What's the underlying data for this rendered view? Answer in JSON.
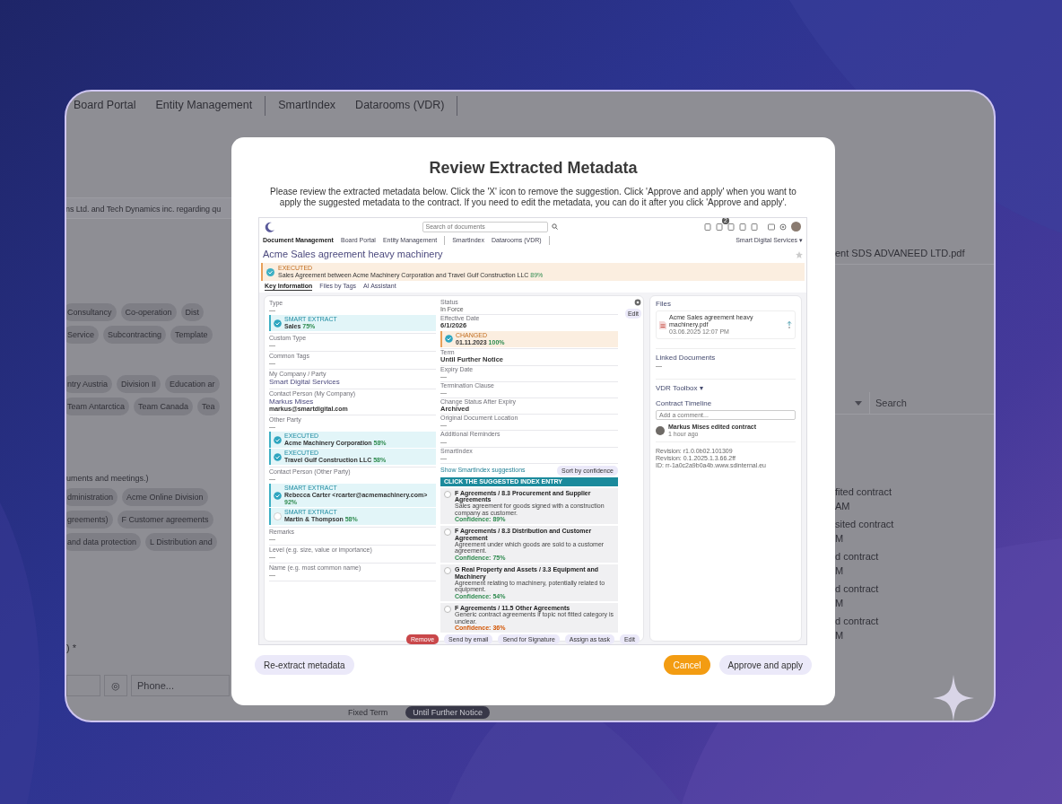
{
  "background": {
    "nav": [
      "Board Portal",
      "Entity Management",
      "SmartIndex",
      "Datarooms (VDR)"
    ],
    "left": [
      {
        "kind": "field",
        "text": "ns Ltd. and Tech Dynamics inc. regarding qu"
      },
      {
        "kind": "tags",
        "tags": [
          "Consultancy",
          "Co-operation",
          "Dist"
        ]
      },
      {
        "kind": "tags",
        "tags": [
          "Service",
          "Subcontracting",
          "Template"
        ]
      },
      {
        "kind": "tags",
        "tags": [
          "ntry Austria",
          "Division II",
          "Education ar"
        ]
      },
      {
        "kind": "tags",
        "tags": [
          "Team Antarctica",
          "Team Canada",
          "Tea"
        ]
      },
      {
        "kind": "note",
        "text": "uments and meetings.)"
      },
      {
        "kind": "tags",
        "tags": [
          "dministration",
          "Acme Online Division"
        ]
      },
      {
        "kind": "tags",
        "tags": [
          "greements)",
          "F Customer agreements"
        ]
      },
      {
        "kind": "tags",
        "tags": [
          "and data protection",
          "L Distribution and"
        ]
      },
      {
        "kind": "label",
        "text": ") *"
      },
      {
        "kind": "phone",
        "icon": "◎",
        "placeholder": "Phone..."
      }
    ],
    "right": [
      {
        "kind": "file",
        "text": "ent SDS ADVANEED LTD.pdf"
      },
      {
        "kind": "search",
        "placeholder": "Search"
      },
      {
        "kind": "timeline",
        "items": [
          {
            "title": "fited contract",
            "time": "AM"
          },
          {
            "title": "sited contract",
            "time": "M"
          },
          {
            "title": "d contract",
            "time": "M"
          },
          {
            "title": "d contract",
            "time": "M"
          },
          {
            "title": "d contract",
            "time": "M"
          }
        ]
      }
    ],
    "term_options": [
      {
        "label": "Fixed Term",
        "selected": false
      },
      {
        "label": "Until Further Notice",
        "selected": true
      }
    ]
  },
  "modal": {
    "title": "Review Extracted Metadata",
    "description": "Please review the extracted metadata below. Click the 'X' icon to remove the suggestion. Click 'Approve and apply' when you want to apply the suggested metadata to the contract. If you need to edit the metadata, you can do it after you click 'Approve and apply'.",
    "buttons": [
      {
        "label": "Re-extract metadata",
        "kind": "secondary"
      },
      {
        "label": "Cancel",
        "kind": "warning"
      },
      {
        "label": "Approve and apply",
        "kind": "secondary"
      }
    ]
  },
  "preview": {
    "search_placeholder": "Search of documents",
    "notification_count": "2",
    "nav": [
      {
        "label": "Document Management",
        "selected": true
      },
      {
        "label": "Board Portal",
        "selected": false
      },
      {
        "label": "Entity Management",
        "selected": false
      },
      {
        "label": "SmartIndex",
        "selected": false
      },
      {
        "label": "Datarooms (VDR)",
        "selected": false
      }
    ],
    "org_menu": "Smart Digital Services ▾",
    "title": "Acme Sales agreement heavy machinery",
    "banner": {
      "tag": "EXECUTED",
      "text": "Sales Agreement between Acme Machinery Corporation and Travel Gulf Construction LLC",
      "confidence": "89%"
    },
    "tabs": [
      {
        "label": "Key Information",
        "selected": true
      },
      {
        "label": "Files by Tags",
        "selected": false
      },
      {
        "label": "AI Assistant",
        "selected": false
      }
    ],
    "columns": [
      [
        {
          "label": "Type",
          "value": "—",
          "kind": "plain",
          "suggestions": [
            {
              "tag": "SMART EXTRACT",
              "value": "Sales",
              "confidence": "75%",
              "checked": true,
              "kind": "new"
            }
          ]
        },
        {
          "label": "Custom Type",
          "value": "—",
          "kind": "plain"
        },
        {
          "label": "Common Tags",
          "value": "—",
          "kind": "plain"
        },
        {
          "label": "My Company / Party",
          "value": "Smart Digital Services",
          "kind": "name"
        },
        {
          "label": "Contact Person (My Company)",
          "value": "Markus Mises",
          "kind": "name",
          "email": "markus@smartdigital.com"
        },
        {
          "label": "Other Party",
          "value": "—",
          "kind": "plain",
          "suggestions": [
            {
              "tag": "EXECUTED",
              "value": "Acme Machinery Corporation",
              "confidence": "58%",
              "checked": true,
              "kind": "new"
            },
            {
              "tag": "EXECUTED",
              "value": "Travel Gulf Construction LLC",
              "confidence": "58%",
              "checked": true,
              "kind": "new"
            }
          ]
        },
        {
          "label": "Contact Person (Other Party)",
          "value": "—",
          "kind": "plain",
          "suggestions": [
            {
              "tag": "SMART EXTRACT",
              "value": "Rebecca Carter <rcarter@acmemachinery.com>",
              "confidence": "92%",
              "checked": true,
              "kind": "new"
            },
            {
              "tag": "SMART EXTRACT",
              "value": "Martin & Thompson",
              "confidence": "58%",
              "checked": false,
              "kind": "new"
            }
          ]
        },
        {
          "label": "Remarks",
          "value": "—",
          "kind": "plain"
        },
        {
          "label": "Level (e.g. size, value or importance)",
          "value": "—",
          "kind": "plain"
        },
        {
          "label": "Name (e.g. most common name)",
          "value": "—",
          "kind": "plain"
        }
      ],
      [
        {
          "label": "Status",
          "value": "In Force",
          "kind": "plain"
        },
        {
          "label": "Effective Date",
          "value": "6/1/2026",
          "kind": "strong",
          "suggestions": [
            {
              "tag": "CHANGED",
              "value": "01.11.2023",
              "confidence": "100%",
              "checked": true,
              "kind": "changed"
            }
          ]
        },
        {
          "label": "Term",
          "value": "Until Further Notice",
          "kind": "strong"
        },
        {
          "label": "Expiry Date",
          "value": "—",
          "kind": "plain"
        },
        {
          "label": "Termination Clause",
          "value": "—",
          "kind": "plain"
        },
        {
          "label": "Change Status After Expiry",
          "value": "Archived",
          "kind": "strong"
        },
        {
          "label": "Original Document Location",
          "value": "—",
          "kind": "plain"
        },
        {
          "label": "Additional Reminders",
          "value": "—",
          "kind": "plain"
        },
        {
          "label": "SmartIndex",
          "value": "—",
          "kind": "plain"
        }
      ]
    ],
    "smartindex": {
      "link": "Show SmartIndex suggestions",
      "sort_button": "Sort by confidence",
      "header": "CLICK THE SUGGESTED INDEX ENTRY",
      "items": [
        {
          "title": "F Agreements / 8.3 Procurement and Supplier Agreements",
          "description": "Sales agreement for goods signed with a construction company as customer.",
          "confidence": "Confidence: 89%",
          "color": "#2e8b4f",
          "selected": false
        },
        {
          "title": "F Agreements / 8.3 Distribution and Customer Agreement",
          "description": "Agreement under which goods are sold to a customer agreement.",
          "confidence": "Confidence: 75%",
          "color": "#2e8b4f",
          "selected": false
        },
        {
          "title": "G Real Property and Assets / 3.3 Equipment and Machinery",
          "description": "Agreement relating to machinery, potentially related to equipment.",
          "confidence": "Confidence: 54%",
          "color": "#2e8b4f",
          "selected": false
        },
        {
          "title": "F Agreements / 11.5 Other Agreements",
          "description": "Generic contract agreements if topic not fitted category is unclear.",
          "confidence": "Confidence: 36%",
          "color": "#d35400",
          "selected": false
        }
      ]
    },
    "edit_button": "Edit",
    "actions": [
      {
        "label": "Remove",
        "kind": "danger"
      },
      {
        "label": "Send by email",
        "kind": "plain"
      },
      {
        "label": "Send for Signature",
        "kind": "plain"
      },
      {
        "label": "Assign as task",
        "kind": "plain"
      },
      {
        "label": "Edit",
        "kind": "plain"
      }
    ],
    "side": {
      "files_title": "Files",
      "file": {
        "name": "Acme Sales agreement heavy machinery.pdf",
        "meta": "03.06.2025 12:07 PM"
      },
      "linked_title": "Linked Documents",
      "linked_value": "—",
      "vdr_toolbox": "VDR Toolbox ▾",
      "timeline_title": "Contract Timeline",
      "comment_placeholder": "Add a comment...",
      "events": [
        {
          "text": "Markus Mises edited contract",
          "time": "1 hour ago"
        }
      ],
      "meta_lines": [
        "Revision: r1.0.0b02.101309",
        "Revision: 0.1.2025.1.3.66.2ff",
        "ID: rr-1a0c2a9b0a4b.www.sdinternal.eu"
      ]
    }
  }
}
